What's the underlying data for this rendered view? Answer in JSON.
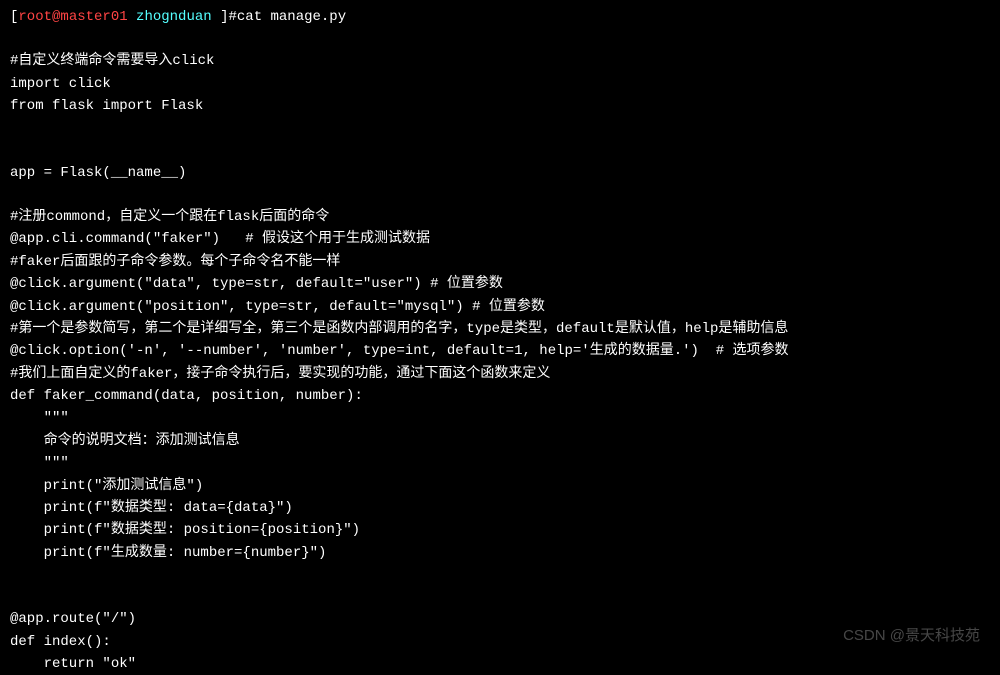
{
  "prompt": {
    "user": "root",
    "at": "@",
    "host": "master01",
    "dir": "zhognduan",
    "cmd": "cat manage.py"
  },
  "code": {
    "blank1": "",
    "comment_import": "#自定义终端命令需要导入click",
    "import_click": "import click",
    "import_flask": "from flask import Flask",
    "blank2": "",
    "blank3": "",
    "app_def": "app = Flask(__name__)",
    "blank4": "",
    "comment_register": "#注册commond，自定义一个跟在flask后面的命令",
    "decorator_cli": "@app.cli.command(\"faker\")   # 假设这个用于生成测试数据",
    "comment_faker_args": "#faker后面跟的子命令参数。每个子命令名不能一样",
    "arg_data": "@click.argument(\"data\", type=str, default=\"user\") # 位置参数",
    "arg_position": "@click.argument(\"position\", type=str, default=\"mysql\") # 位置参数",
    "comment_params": "#第一个是参数简写，第二个是详细写全，第三个是函数内部调用的名字，type是类型，default是默认值，help是辅助信息",
    "option_number": "@click.option('-n', '--number', 'number', type=int, default=1, help='生成的数据量.')  # 选项参数",
    "comment_custom": "#我们上面自定义的faker，接子命令执行后，要实现的功能，通过下面这个函数来定义",
    "def_faker": "def faker_command(data, position, number):",
    "docstring1": "    \"\"\"",
    "docstring2": "    命令的说明文档：添加测试信息",
    "docstring3": "    \"\"\"",
    "print1": "    print(\"添加测试信息\")",
    "print2": "    print(f\"数据类型: data={data}\")",
    "print3": "    print(f\"数据类型: position={position}\")",
    "print4": "    print(f\"生成数量: number={number}\")",
    "blank5": "",
    "blank6": "",
    "route": "@app.route(\"/\")",
    "def_index": "def index():",
    "return_ok": "    return \"ok\""
  },
  "watermark": "CSDN @景天科技苑"
}
